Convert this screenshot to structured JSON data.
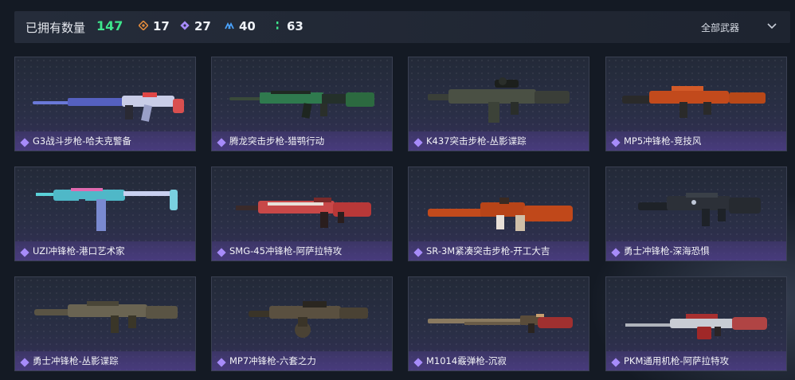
{
  "header": {
    "title": "已拥有数量",
    "total": "147",
    "rarities": [
      {
        "icon": "orange-diamond-icon",
        "count": "17",
        "color": "#e08a3c"
      },
      {
        "icon": "purple-diamond-icon",
        "count": "27",
        "color": "#a78bfa"
      },
      {
        "icon": "blue-chevrons-icon",
        "count": "40",
        "color": "#4aa3ff"
      },
      {
        "icon": "green-dots-icon",
        "count": "63",
        "color": "#3ee58c"
      }
    ],
    "filter_label": "全部武器"
  },
  "weapons": [
    {
      "name": "G3战斗步枪-哈夫克警备"
    },
    {
      "name": "腾龙突击步枪-猎鹗行动"
    },
    {
      "name": "K437突击步枪-丛影谍踪"
    },
    {
      "name": "MP5冲锋枪-竞技风"
    },
    {
      "name": "UZI冲锋枪-港口艺术家"
    },
    {
      "name": "SMG-45冲锋枪-阿萨拉特攻"
    },
    {
      "name": "SR-3M紧凑突击步枪-开工大吉"
    },
    {
      "name": "勇士冲锋枪-深海恐惧"
    },
    {
      "name": "勇士冲锋枪-丛影谍踪"
    },
    {
      "name": "MP7冲锋枪-六套之力"
    },
    {
      "name": "M1014霰弹枪-沉寂"
    },
    {
      "name": "PKM通用机枪-阿萨拉特攻"
    }
  ],
  "colors": {
    "accent_green": "#3ee58c",
    "rarity_purple": "#a78bfa"
  }
}
